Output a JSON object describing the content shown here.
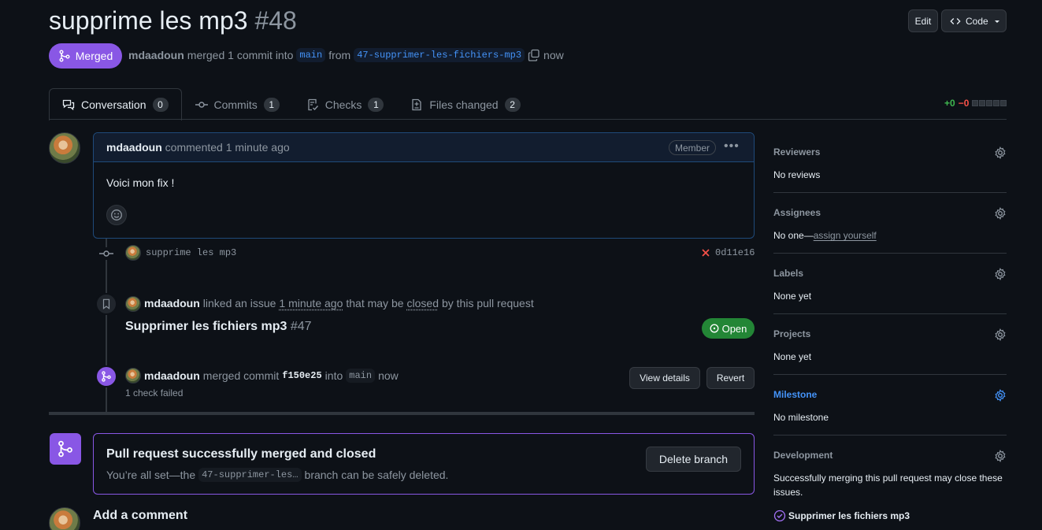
{
  "header": {
    "title": "supprime les mp3",
    "number": "#48",
    "edit_label": "Edit",
    "code_label": "Code",
    "state": "Merged",
    "author": "mdaadoun",
    "merge_text": "merged 1 commit into",
    "base_branch": "main",
    "from_text": "from",
    "head_branch": "47-supprimer-les-fichiers-mp3",
    "time": "now"
  },
  "tabs": [
    {
      "label": "Conversation",
      "count": "0"
    },
    {
      "label": "Commits",
      "count": "1"
    },
    {
      "label": "Checks",
      "count": "1"
    },
    {
      "label": "Files changed",
      "count": "2"
    }
  ],
  "diffstat": {
    "additions": "+0",
    "deletions": "−0"
  },
  "comment": {
    "author": "mdaadoun",
    "action": "commented",
    "time": "1 minute ago",
    "badge": "Member",
    "body": "Voici mon fix !"
  },
  "commit": {
    "message": "supprime les mp3",
    "sha": "0d11e16"
  },
  "linked_issue": {
    "author": "mdaadoun",
    "text1": "linked an issue",
    "time": "1 minute ago",
    "text2": "that may be",
    "closed": "closed",
    "text3": "by this pull request",
    "issue_title": "Supprimer les fichiers mp3",
    "issue_number": "#47",
    "state": "Open"
  },
  "merge_event": {
    "author": "mdaadoun",
    "text1": "merged commit",
    "sha": "f150e25",
    "text2": "into",
    "branch": "main",
    "time": "now",
    "checks": "1 check failed",
    "view_details": "View details",
    "revert": "Revert"
  },
  "merged_box": {
    "title": "Pull request successfully merged and closed",
    "sub1": "You’re all set—the",
    "branch": "47-supprimer-les…",
    "sub2": "branch can be safely deleted.",
    "delete_label": "Delete branch"
  },
  "add_comment": "Add a comment",
  "sidebar": {
    "reviewers": {
      "title": "Reviewers",
      "value": "No reviews"
    },
    "assignees": {
      "title": "Assignees",
      "value": "No one—",
      "link": "assign yourself"
    },
    "labels": {
      "title": "Labels",
      "value": "None yet"
    },
    "projects": {
      "title": "Projects",
      "value": "None yet"
    },
    "milestone": {
      "title": "Milestone",
      "value": "No milestone"
    },
    "development": {
      "title": "Development",
      "value": "Successfully merging this pull request may close these issues.",
      "issue": "Supprimer les fichiers mp3"
    }
  },
  "colors": {
    "merged": "#8957e5",
    "open": "#238636",
    "accent": "#4493f8",
    "bg": "#0d1117"
  }
}
